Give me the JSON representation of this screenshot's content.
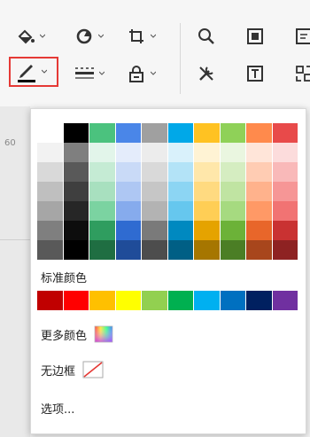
{
  "ruler": {
    "label": "60"
  },
  "toolbar": {
    "buttons": [
      "fill-tool",
      "shape-tool",
      "crop-tool",
      "zoom-tool",
      "fit-page",
      "line-color",
      "line-style",
      "lock-tool",
      "tools",
      "text-box"
    ]
  },
  "palette": {
    "theme_rows": [
      [
        "#FFFFFF",
        "#000000",
        "#4BC27E",
        "#4A86E8",
        "#A0A0A0",
        "#00A8E8",
        "#FFC222",
        "#8FD158",
        "#FF8A4C",
        "#E84A4A"
      ],
      [
        "#F2F2F2",
        "#7F7F7F",
        "#E2F5EA",
        "#E4ECFB",
        "#ECECEC",
        "#D9F1FB",
        "#FFF3D4",
        "#EAF6E0",
        "#FFE5D9",
        "#FCDCDC"
      ],
      [
        "#D9D9D9",
        "#595959",
        "#C5EBD4",
        "#C9DAF7",
        "#D9D9D9",
        "#B3E3F7",
        "#FFE7AA",
        "#D5EDC1",
        "#FFCCB3",
        "#F9B9B9"
      ],
      [
        "#BFBFBF",
        "#3F3F3F",
        "#A8E0BF",
        "#AEC7F3",
        "#C6C6C6",
        "#8CD5F3",
        "#FFDA80",
        "#C0E4A2",
        "#FFB28C",
        "#F69696"
      ],
      [
        "#A6A6A6",
        "#262626",
        "#7BD3A1",
        "#86ABED",
        "#B3B3B3",
        "#66C7EE",
        "#FFCE55",
        "#A6DA80",
        "#FF9966",
        "#F17373"
      ],
      [
        "#7F7F7F",
        "#0D0D0D",
        "#2F9D5F",
        "#2F6BD1",
        "#7A7A7A",
        "#0089C0",
        "#E5A300",
        "#6CB238",
        "#E8662A",
        "#C93232"
      ],
      [
        "#595959",
        "#000000",
        "#1F6E42",
        "#1F4C99",
        "#4D4D4D",
        "#005F85",
        "#A67600",
        "#4B7E25",
        "#A8461C",
        "#8E2222"
      ]
    ],
    "standard_label": "标准颜色",
    "standard_colors": [
      "#C00000",
      "#FF0000",
      "#FFC000",
      "#FFFF00",
      "#92D050",
      "#00B050",
      "#00B0F0",
      "#0070C0",
      "#002060",
      "#7030A0"
    ],
    "more_colors_label": "更多颜色",
    "no_border_label": "无边框",
    "options_label": "选项..."
  }
}
